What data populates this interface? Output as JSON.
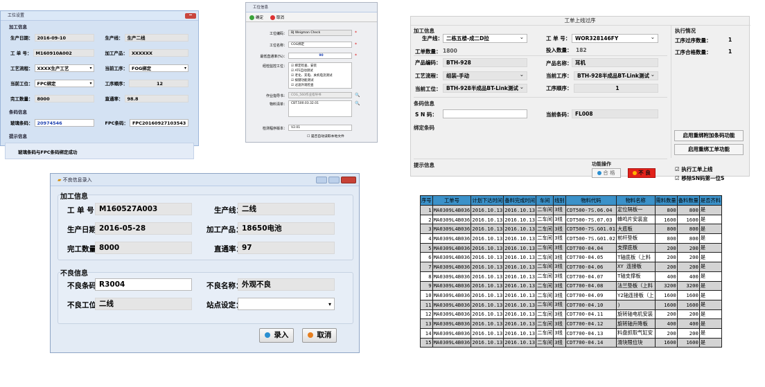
{
  "w1": {
    "title": "工位设置",
    "sec1": "加工信息",
    "prod_date_lbl": "生产日期：",
    "prod_date": "2016-09-10",
    "line_lbl": "生产线：",
    "line": "生产二线",
    "order_lbl": "工 单 号：",
    "order": "M160910A002",
    "product_lbl": "加工产品：",
    "product": "XXXXXX",
    "flow_lbl": "工艺流程：",
    "flow": "XXXX生产工艺",
    "proc_lbl": "当前工序：",
    "proc": "FOG绑定",
    "station_lbl": "当前工位：",
    "station": "FPC绑定",
    "seq_lbl": "工序顺序：",
    "seq": "12",
    "done_lbl": "完工数量：",
    "done": "8000",
    "rate_lbl": "直通率：",
    "rate": "98.8",
    "sec2": "条码信息",
    "glass_lbl": "玻璃条码：",
    "glass": "20974546",
    "fpc_lbl": "FPC条码：",
    "fpc": "FPC20160927103543",
    "sec3": "提示信息",
    "msg": "玻璃条码与FPC条码绑定成功"
  },
  "w2": {
    "title": "工位信息",
    "save": "确定",
    "cancel": "取消",
    "code_lbl": "工位编码：",
    "code": "BJ Weigman Check",
    "name_lbl": "工位名称：",
    "name": "COG绑定",
    "rate_lbl": "最低直通率(%)：",
    "rate": "90",
    "checks_lbl": "经检监控工位：",
    "checks": [
      "绑定检查、安装",
      "ATE自动测试",
      "老化、充电、关机电流测试",
      "按键功能测试",
      "过滤外观检查"
    ],
    "instr_lbl": "作业指导书：",
    "instr": "COG_560作业指导书",
    "bom_lbl": "物料清单：",
    "bom": "CBT.500.03.32.01",
    "ver_lbl": "检测程序版本：",
    "ver": "V2.01",
    "auto_chk": "是否自动读取本地文件"
  },
  "w3": {
    "caption": "工单上线过序",
    "proc_info": "加工信息",
    "line_lbl": "生产线：",
    "line": "二栋五楼-成二D拉",
    "order_lbl": "工 单 号：",
    "order": "WOR328146FY",
    "qty_lbl": "工单数量：",
    "qty": "1800",
    "input_lbl": "投入数量：",
    "input": "182",
    "pcode_lbl": "产品编码：",
    "pcode": "BTH-928",
    "pname_lbl": "产品名称：",
    "pname": "耳机",
    "flow_lbl": "工艺流程：",
    "flow": "组装-手动",
    "proc_lbl": "当前工序：",
    "proc": "BTH-928半成品BT-Link测试",
    "station_lbl": "当前工位：",
    "station": "BTH-928半成品BT-Link测试",
    "seq_lbl": "工序顺序：",
    "seq": "1",
    "exec_title": "执行情况",
    "pass_count_lbl": "工序过序数量：",
    "pass_count": "1",
    "ok_count_lbl": "工序合格数量：",
    "ok_count": "1",
    "barcode_info": "条码信息",
    "sn_lbl": "S N 码：",
    "sn": "",
    "cur_bar_lbl": "当前条码：",
    "cur_bar": "FL008",
    "bind_lbl": "绑定条码",
    "btn_rebind": "启用重绑附加条码功能",
    "btn_reorder": "启用重绑工单功能",
    "tips_lbl": "提示信息",
    "func_lbl": "功能操作",
    "ok_btn": "合 格",
    "ng_btn": "不 良",
    "chk1": "执行工单上线",
    "chk2": "移除SN码第一位S"
  },
  "w4": {
    "title": "不良信息录入",
    "g1": "加工信息",
    "order_lbl": "工 单 号：",
    "order": "M160527A003",
    "line_lbl": "生产线：",
    "line": "二线",
    "date_lbl": "生产日期：",
    "date": "2016-05-28",
    "product_lbl": "加工产品：",
    "product": "18650电池",
    "done_lbl": "完工数量：",
    "done": "8000",
    "rate_lbl": "直通率：",
    "rate": "97",
    "g2": "不良信息",
    "ngbar_lbl": "不良条码：",
    "ngbar": "R3004",
    "ngname_lbl": "不良名称：",
    "ngname": "外观不良",
    "ngst_lbl": "不良工位：",
    "ngst": "二线",
    "site_lbl": "站点设定：",
    "site": "",
    "enter": "录入",
    "cancel": "取消"
  },
  "table": {
    "headers": [
      "序号",
      "工单号",
      "计划下达时间",
      "备料完成时间",
      "车间",
      "线别",
      "物料代码",
      "物料名称",
      "需料数量",
      "备料数量",
      "是否齐料"
    ],
    "rows": [
      [
        "1",
        "MA0309L4B036",
        "2016.10.13",
        "2016.10.13",
        "二车间",
        "3线",
        "CDT500-7S.06.04",
        "定位隔板一",
        "800",
        "800",
        "是"
      ],
      [
        "2",
        "MA0309L4B036",
        "2016.10.13",
        "2016.10.13",
        "二车间",
        "3线",
        "CDT500-7S.07.03",
        "蜂鸣片安装盒",
        "1600",
        "1600",
        "是"
      ],
      [
        "3",
        "MA0309L4B036",
        "2016.10.13",
        "2016.10.13",
        "二车间",
        "3线",
        "CDT500-7S.G01.01",
        "大底板",
        "800",
        "800",
        "是"
      ],
      [
        "4",
        "MA0309L4B036",
        "2016.10.13",
        "2016.10.13",
        "二车间",
        "3线",
        "CDT500-7S.G01.02",
        "前杆垫板",
        "800",
        "800",
        "是"
      ],
      [
        "5",
        "MA0309L4B036",
        "2016.10.13",
        "2016.10.13",
        "二车间",
        "3线",
        "CDT700-04.04",
        "支撑底板",
        "200",
        "200",
        "是"
      ],
      [
        "6",
        "MA0309L4B036",
        "2016.10.13",
        "2016.10.13",
        "二车间",
        "3线",
        "CDT700-04.05",
        "T轴底板（上料",
        "200",
        "200",
        "是"
      ],
      [
        "7",
        "MA0309L4B036",
        "2016.10.13",
        "2016.10.13",
        "二车间",
        "3线",
        "CDT700-04.06",
        "XY 连接板",
        "200",
        "200",
        "是"
      ],
      [
        "8",
        "MA0309L4B036",
        "2016.10.13",
        "2016.10.13",
        "二车间",
        "3线",
        "CDT700-04.07",
        "T轴支撑板",
        "400",
        "400",
        "是"
      ],
      [
        "9",
        "MA0309L4B036",
        "2016.10.13",
        "2016.10.13",
        "二车间",
        "3线",
        "CDT700-04.08",
        "法兰垫板（上料",
        "3200",
        "3200",
        "是"
      ],
      [
        "10",
        "MA0309L4B036",
        "2016.10.13",
        "2016.10.13",
        "二车间",
        "3线",
        "CDT700-04.09",
        "Y2轴连接板（上",
        "1600",
        "1600",
        "是"
      ],
      [
        "11",
        "MA0309L4B036",
        "2016.10.13",
        "2016.10.13",
        "二车间",
        "3线",
        "CDT700-04.10",
        ")",
        "1600",
        "1600",
        "是"
      ],
      [
        "12",
        "MA0309L4B036",
        "2016.10.13",
        "2016.10.13",
        "二车间",
        "3线",
        "CDT700-04.11",
        "旋转轴电机安装",
        "200",
        "200",
        "是"
      ],
      [
        "13",
        "MA0309L4B036",
        "2016.10.13",
        "2016.10.13",
        "二车间",
        "3线",
        "CDT700-04.12",
        "旋转轴升降板",
        "400",
        "400",
        "是"
      ],
      [
        "14",
        "MA0309L4B036",
        "2016.10.13",
        "2016.10.13",
        "二车间",
        "3线",
        "CDT700-04.13",
        "料盘抓取气缸安",
        "200",
        "200",
        "是"
      ],
      [
        "15",
        "MA0309L4B036",
        "2016.10.13",
        "2016.10.13",
        "二车间",
        "3线",
        "CDT700-04.14",
        "滑块限位块",
        "1600",
        "1600",
        "是"
      ]
    ]
  }
}
